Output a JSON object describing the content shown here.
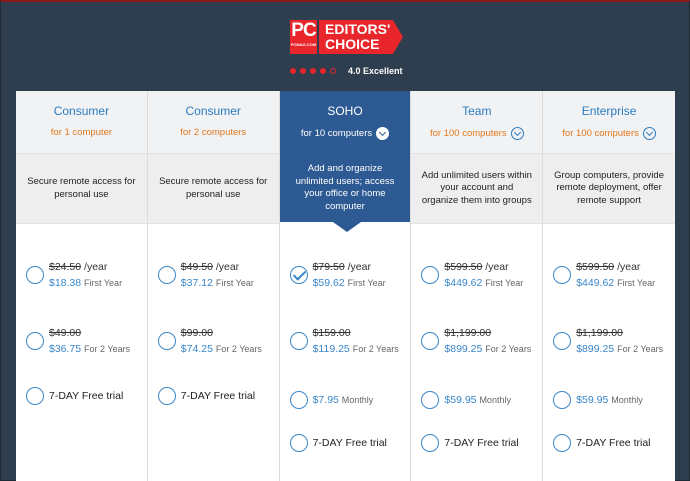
{
  "badge": {
    "logo_text": "PC",
    "logo_sub": "PCMAG.COM",
    "editors_line1": "EDITORS'",
    "editors_line2": "CHOICE",
    "rating_filled": 4,
    "rating_total": 5,
    "rating_text": "4.0 Excellent",
    "brand_color": "#e8262b"
  },
  "plans": [
    {
      "name": "Consumer",
      "sub": "for 1 computer",
      "desc": "Secure remote access for personal use",
      "options": [
        {
          "old": "$24.50",
          "old_suffix": " /year",
          "price": "$18.38",
          "note": "First Year",
          "checked": false
        },
        {
          "old": "$49.00",
          "old_suffix": "",
          "price": "$36.75",
          "note": "For 2 Years",
          "checked": false
        },
        {
          "trial": "7-DAY Free trial",
          "checked": false
        }
      ]
    },
    {
      "name": "Consumer",
      "sub": "for 2 computers",
      "desc": "Secure remote access for personal use",
      "options": [
        {
          "old": "$49.50",
          "old_suffix": " /year",
          "price": "$37.12",
          "note": "First Year",
          "checked": false
        },
        {
          "old": "$99.00",
          "old_suffix": "",
          "price": "$74.25",
          "note": "For 2 Years",
          "checked": false
        },
        {
          "trial": "7-DAY Free trial",
          "checked": false
        }
      ]
    },
    {
      "name": "SOHO",
      "sub": "for 10 computers",
      "desc": "Add and organize unlimited users; access your office or home computer",
      "options": [
        {
          "old": "$79.50",
          "old_suffix": " /year",
          "price": "$59.62",
          "note": "First Year",
          "checked": true
        },
        {
          "old": "$159.00",
          "old_suffix": "",
          "price": "$119.25",
          "note": "For 2 Years",
          "checked": false
        },
        {
          "price": "$7.95",
          "note": "Monthly",
          "checked": false
        },
        {
          "trial": "7-DAY Free trial",
          "checked": false
        }
      ]
    },
    {
      "name": "Team",
      "sub": "for 100 computers",
      "desc": "Add unlimited users within your account and organize them into groups",
      "options": [
        {
          "old": "$599.50",
          "old_suffix": " /year",
          "price": "$449.62",
          "note": "First Year",
          "checked": false
        },
        {
          "old": "$1,199.00",
          "old_suffix": "",
          "price": "$899.25",
          "note": "For 2 Years",
          "checked": false
        },
        {
          "price": "$59.95",
          "note": "Monthly",
          "checked": false
        },
        {
          "trial": "7-DAY Free trial",
          "checked": false
        }
      ]
    },
    {
      "name": "Enterprise",
      "sub": "for 100 computers",
      "desc": "Group computers, provide remote deployment, offer remote support",
      "options": [
        {
          "old": "$599.50",
          "old_suffix": " /year",
          "price": "$449.62",
          "note": "First Year",
          "checked": false
        },
        {
          "old": "$1,199.00",
          "old_suffix": "",
          "price": "$899.25",
          "note": "For 2 Years",
          "checked": false
        },
        {
          "price": "$59.95",
          "note": "Monthly",
          "checked": false
        },
        {
          "trial": "7-DAY Free trial",
          "checked": false
        }
      ]
    }
  ],
  "active_plan": 2,
  "colors": {
    "accent": "#3a86c8",
    "highlight": "#2d5a92",
    "sub_label": "#e0791e",
    "background": "#2e3e4e"
  }
}
